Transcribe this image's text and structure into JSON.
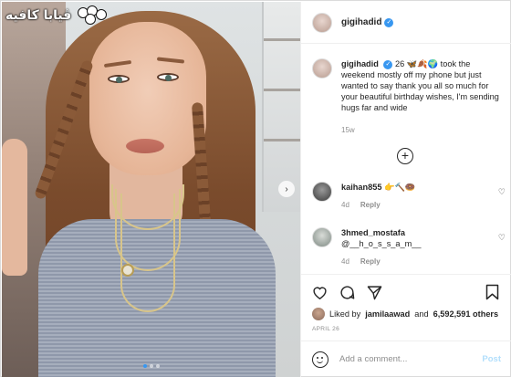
{
  "watermark": {
    "text": "ڤيابا كافيه"
  },
  "header": {
    "username": "gigihadid",
    "verified_icon": "verified-badge-icon"
  },
  "caption": {
    "username": "gigihadid",
    "number": "26",
    "emojis": [
      "🦋",
      "🍂",
      "🌍"
    ],
    "text": "took the weekend mostly off my phone but just wanted to say thank you all so much for your beautiful birthday wishes, I'm sending hugs far and wide",
    "time": "15w"
  },
  "load_more": {
    "icon": "plus-circle-icon"
  },
  "comments": [
    {
      "username": "kaihan855",
      "text": "👉🔨🍩",
      "time": "4d",
      "reply": "Reply"
    },
    {
      "username": "3hmed_mostafa",
      "text": "@__h_o_s_s_a_m__",
      "time": "4d",
      "reply": "Reply"
    }
  ],
  "likes": {
    "prefix": "Liked by",
    "user": "jamilaawad",
    "and": "and",
    "count": "6,592,591 others"
  },
  "post_date": "APRIL 26",
  "comment_box": {
    "placeholder": "Add a comment...",
    "post_label": "Post"
  },
  "colors": {
    "accent": "#3897f0",
    "text": "#262626",
    "muted": "#8e8e8e",
    "post_disabled": "#b2dffc"
  }
}
